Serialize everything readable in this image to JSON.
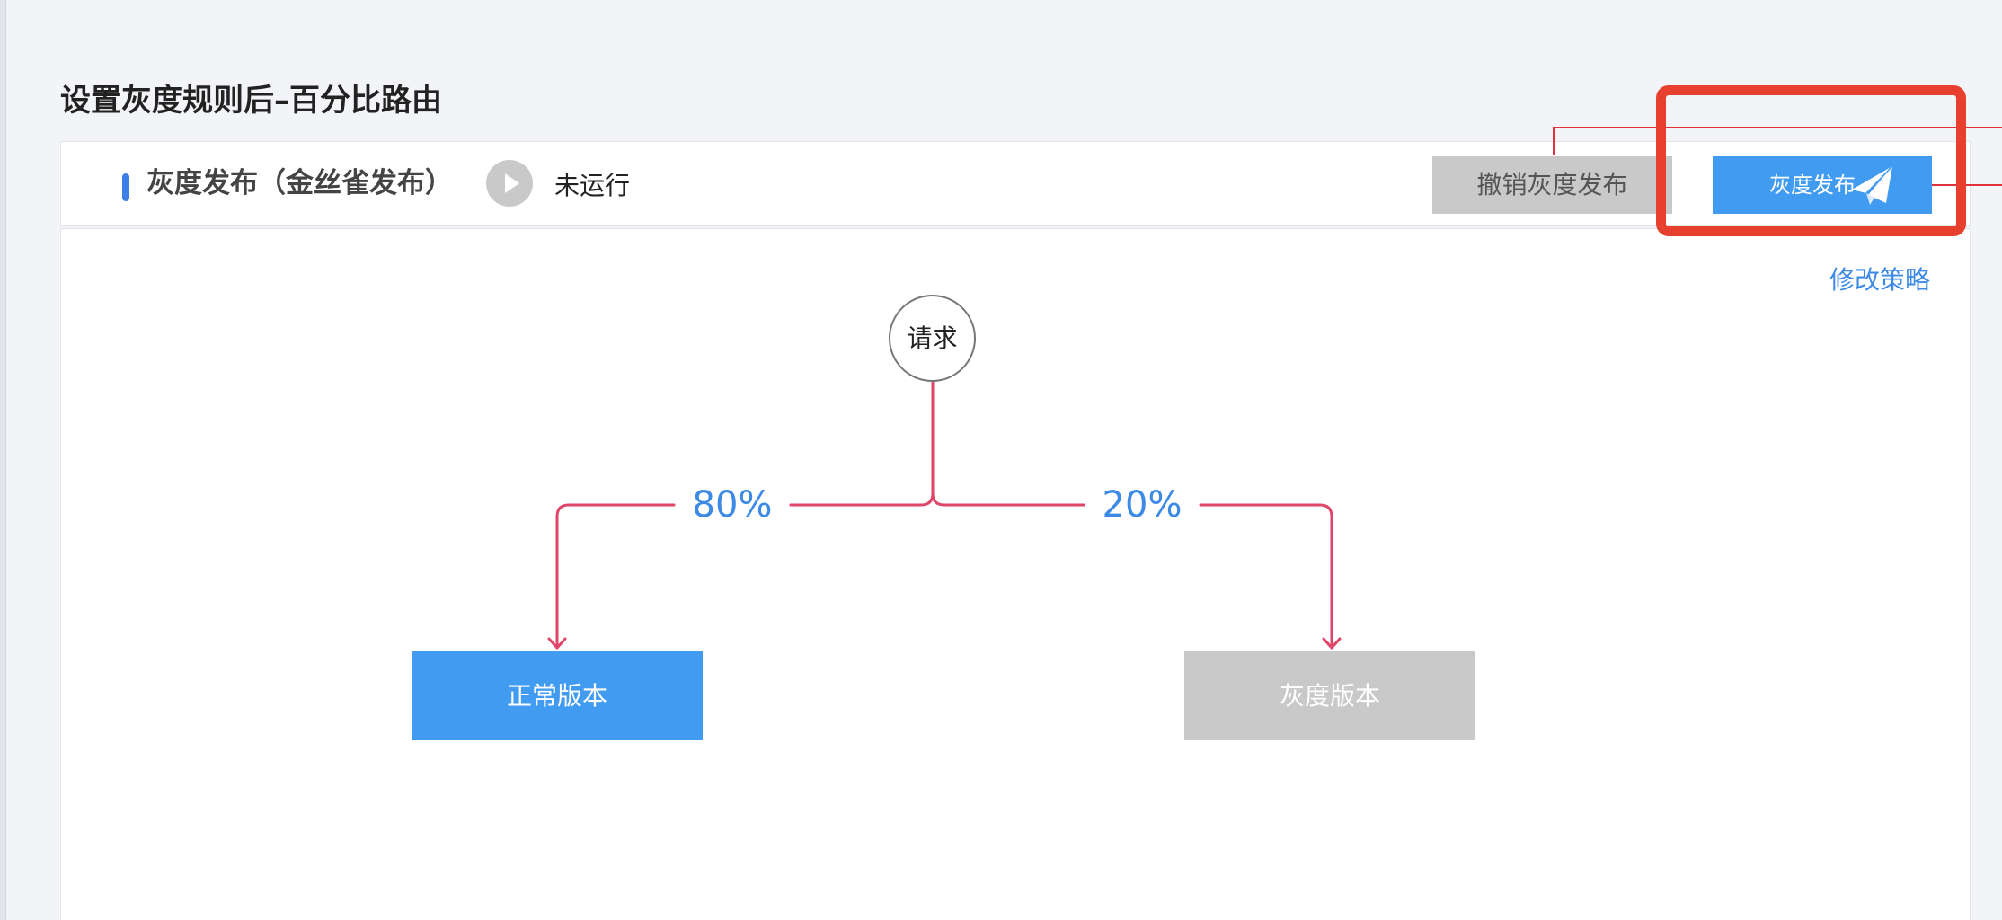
{
  "page": {
    "title": "设置灰度规则后–百分比路由"
  },
  "header": {
    "section_title": "灰度发布（金丝雀发布）",
    "status": "未运行",
    "cancel_label": "撤销灰度发布",
    "publish_label": "灰度发布",
    "publish_icon": "paper-plane-icon",
    "play_icon": "play-icon"
  },
  "body": {
    "edit_link": "修改策略",
    "request_node": "请求",
    "routes": [
      {
        "percent": "80%",
        "target": "正常版本"
      },
      {
        "percent": "20%",
        "target": "灰度版本"
      }
    ]
  },
  "colors": {
    "accent_blue": "#419bf1",
    "link_blue": "#3d8ae6",
    "flow_line": "#e0456a",
    "inactive_gray": "#c9c9c9",
    "annotation_red": "#e8402e"
  }
}
